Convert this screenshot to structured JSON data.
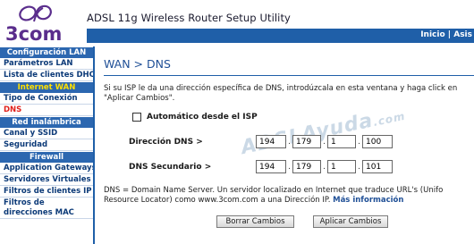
{
  "header": {
    "logo_text": "3com",
    "app_title": "ADSL 11g Wireless Router Setup Utility",
    "links": [
      "Inicio",
      "Asis"
    ],
    "link_separator": "|"
  },
  "sidebar": {
    "sections": [
      {
        "title": "Configuración LAN",
        "items": [
          {
            "label": "Parámetros LAN"
          },
          {
            "label": "Lista de clientes DHCP"
          }
        ]
      },
      {
        "title": "Internet WAN",
        "items": [
          {
            "label": "Tipo de Conexión"
          },
          {
            "label": "DNS"
          }
        ]
      },
      {
        "title": "Red inalámbrica",
        "items": [
          {
            "label": "Canal y SSID"
          },
          {
            "label": "Seguridad"
          }
        ]
      },
      {
        "title": "Firewall",
        "items": [
          {
            "label": "Application Gateways"
          },
          {
            "label": "Servidores Virtuales"
          },
          {
            "label": "Filtros de clientes IP"
          },
          {
            "label": "Filtros de direcciones MAC"
          }
        ]
      }
    ],
    "active_item": "DNS"
  },
  "main": {
    "title": "WAN > DNS",
    "intro": "Si su ISP le da una dirección específica de DNS, introdúzcala en esta ventana y haga click en \"Aplicar Cambios\".",
    "auto_isp_label": "Automático desde el ISP",
    "auto_isp_checked": false,
    "dns_primary": {
      "label": "Dirección DNS >",
      "octets": [
        "194",
        "179",
        "1",
        "100"
      ]
    },
    "dns_secondary": {
      "label": "DNS Secundario >",
      "octets": [
        "194",
        "179",
        "1",
        "101"
      ]
    },
    "watermark": "ADSLAyuda",
    "watermark_suffix": ".com",
    "note": "DNS = Domain Name Server. Un servidor localizado en Internet que traduce URL's (Unifo Resource Locator) como www.3com.com a una Dirección IP.",
    "more_info": "Más información",
    "buttons": {
      "clear": "Borrar Cambios",
      "apply": "Aplicar Cambios"
    }
  },
  "colors": {
    "brand_blue": "#1f5fa8",
    "active_red": "#e0201b",
    "internet_yellow": "#ffe000",
    "logo_purple": "#5a2d8c"
  }
}
